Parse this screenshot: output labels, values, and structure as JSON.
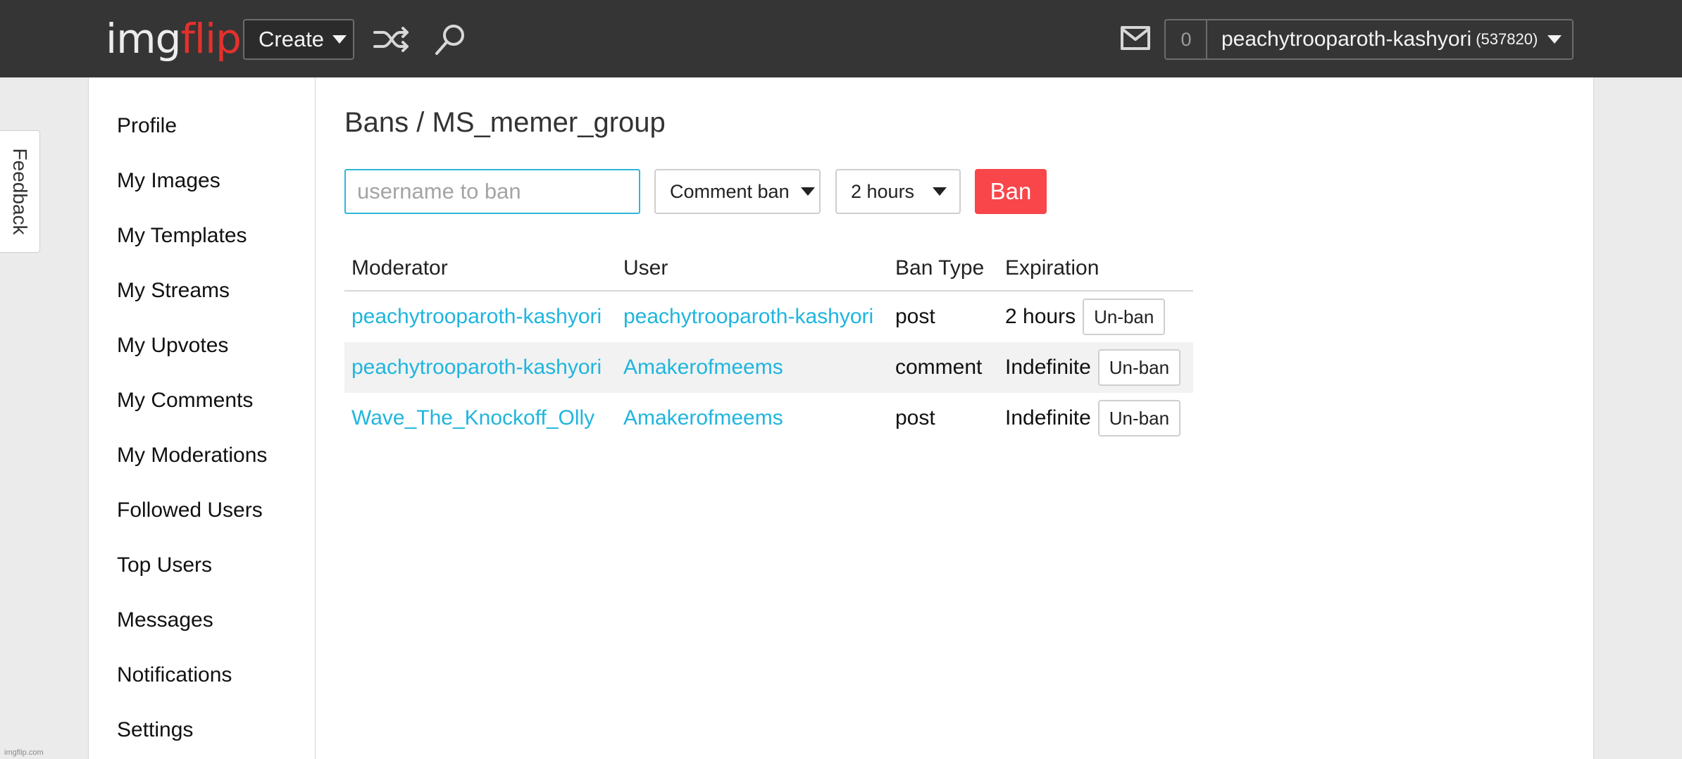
{
  "header": {
    "logo_img": "img",
    "logo_flip": "flip",
    "create_label": "Create",
    "shuffle_icon": "shuffle-icon",
    "search_icon": "search-icon",
    "mail_icon": "mail-icon",
    "notification_count": "0",
    "username": "peachytrooparoth-kashyori",
    "points": "(537820)"
  },
  "feedback_label": "Feedback",
  "sidebar": {
    "items": [
      {
        "label": "Profile"
      },
      {
        "label": "My Images"
      },
      {
        "label": "My Templates"
      },
      {
        "label": "My Streams"
      },
      {
        "label": "My Upvotes"
      },
      {
        "label": "My Comments"
      },
      {
        "label": "My Moderations"
      },
      {
        "label": "Followed Users"
      },
      {
        "label": "Top Users"
      },
      {
        "label": "Messages"
      },
      {
        "label": "Notifications"
      },
      {
        "label": "Settings"
      }
    ]
  },
  "main": {
    "title": "Bans / MS_memer_group",
    "ban_form": {
      "username_placeholder": "username to ban",
      "ban_type_selected": "Comment ban",
      "duration_selected": "2 hours",
      "ban_button": "Ban"
    },
    "table": {
      "headers": {
        "moderator": "Moderator",
        "user": "User",
        "ban_type": "Ban Type",
        "expiration": "Expiration"
      },
      "unban_label": "Un-ban",
      "rows": [
        {
          "moderator": "peachytrooparoth-kashyori",
          "user": "peachytrooparoth-kashyori",
          "ban_type": "post",
          "expiration": "2 hours"
        },
        {
          "moderator": "peachytrooparoth-kashyori",
          "user": "Amakerofmeems",
          "ban_type": "comment",
          "expiration": "Indefinite"
        },
        {
          "moderator": "Wave_The_Knockoff_Olly",
          "user": "Amakerofmeems",
          "ban_type": "post",
          "expiration": "Indefinite"
        }
      ]
    }
  },
  "footer_tag": "imgflip.com",
  "colors": {
    "topbar": "#353535",
    "brand_red": "#e3312d",
    "link": "#1fb5de",
    "ban_button": "#f8464b",
    "input_focus": "#2fb6d9"
  }
}
